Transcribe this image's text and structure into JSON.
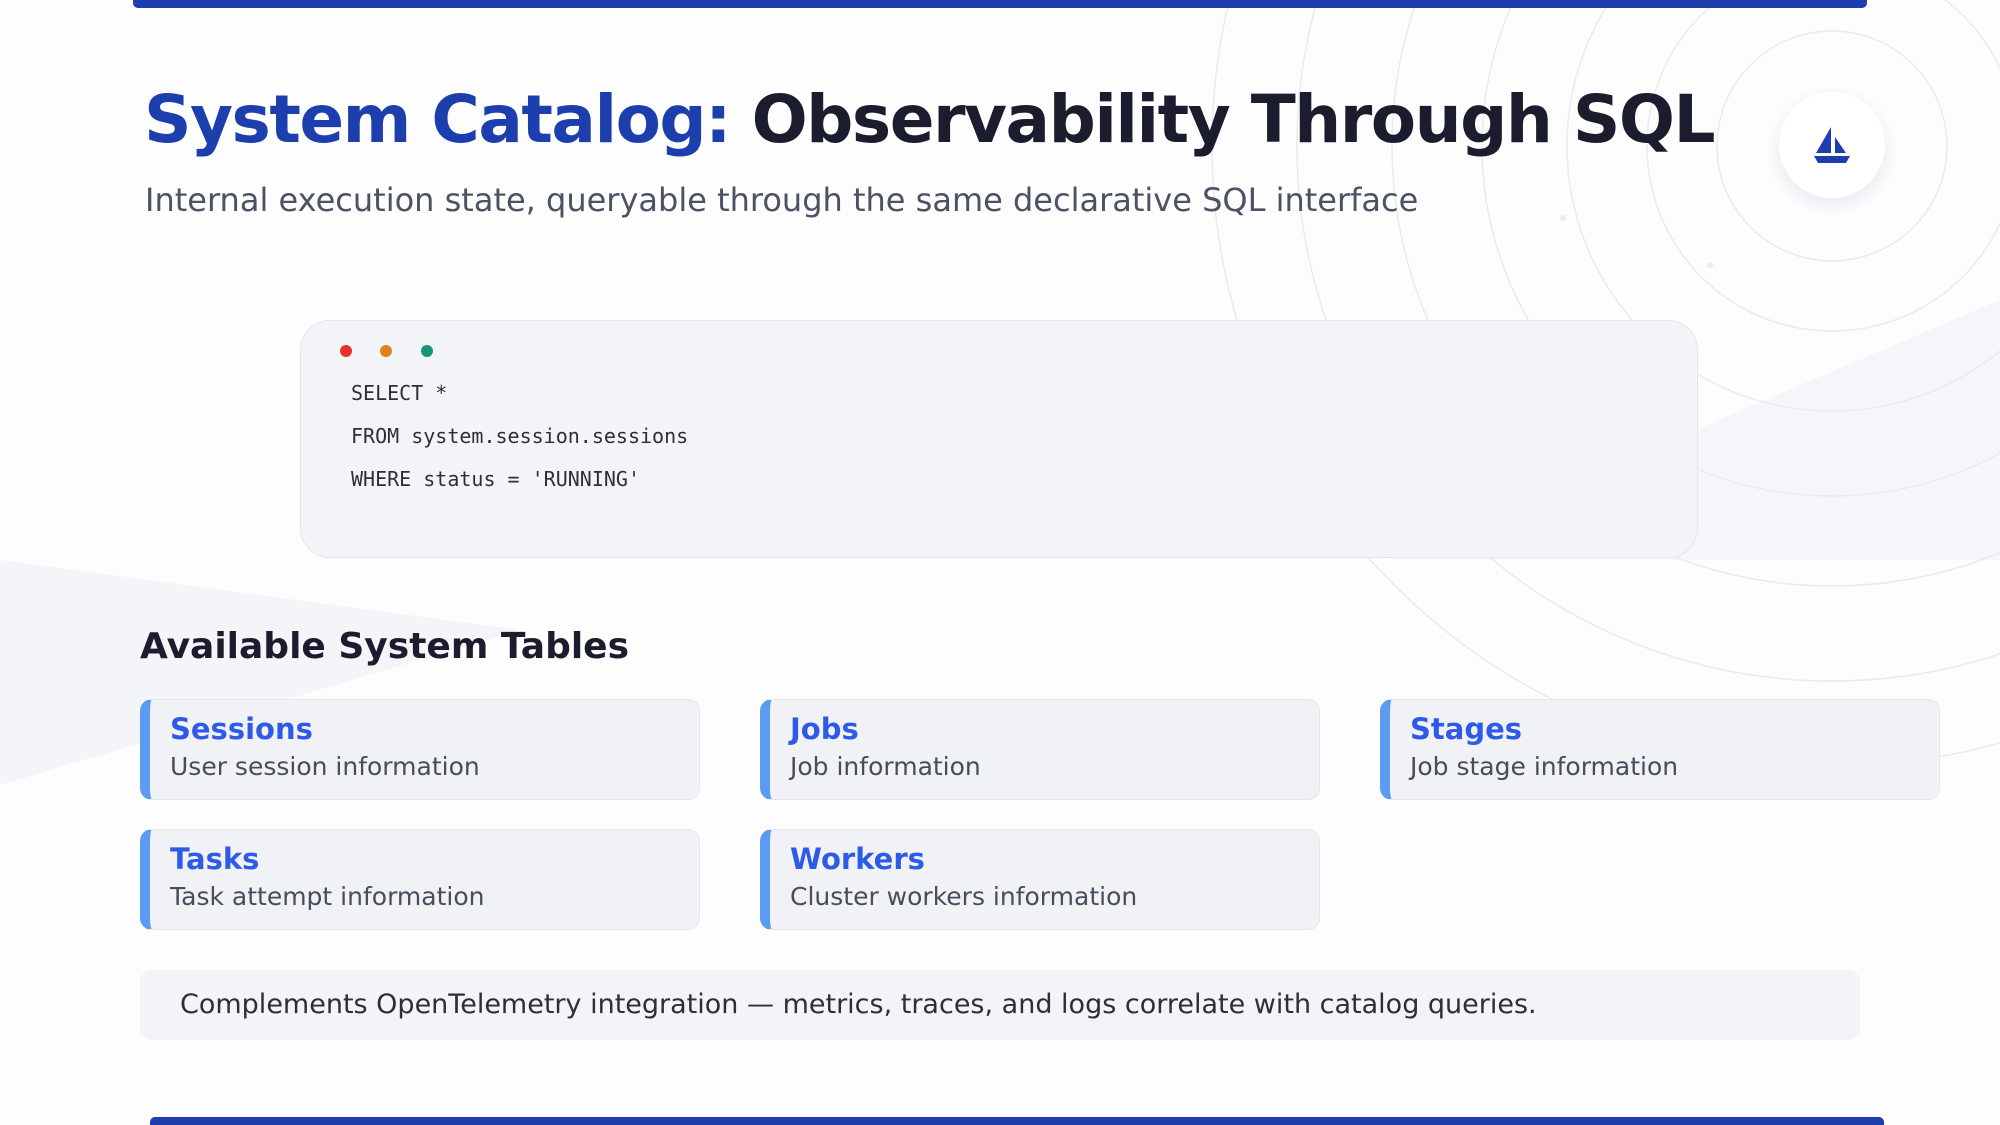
{
  "header": {
    "title_accent": "System Catalog:",
    "title_rest": "Observability Through SQL",
    "subtitle": "Internal execution state, queryable through the same declarative SQL interface",
    "logo_icon": "sailboat-icon"
  },
  "code_window": {
    "lines": [
      "SELECT *",
      "FROM system.session.sessions",
      "WHERE status = 'RUNNING'"
    ],
    "dot_colors": [
      "#e5322d",
      "#e3821a",
      "#14967a"
    ]
  },
  "tables_section": {
    "heading": "Available System Tables",
    "items": [
      {
        "name": "Sessions",
        "description": "User session information"
      },
      {
        "name": "Jobs",
        "description": "Job information"
      },
      {
        "name": "Stages",
        "description": "Job stage information"
      },
      {
        "name": "Tasks",
        "description": "Task attempt information"
      },
      {
        "name": "Workers",
        "description": "Cluster workers information"
      }
    ]
  },
  "footnote": "Complements OpenTelemetry integration — metrics, traces, and logs correlate with catalog queries.",
  "colors": {
    "brand": "#1d3fae",
    "card_accent": "#5b9cf2",
    "card_title": "#2d5be8"
  }
}
